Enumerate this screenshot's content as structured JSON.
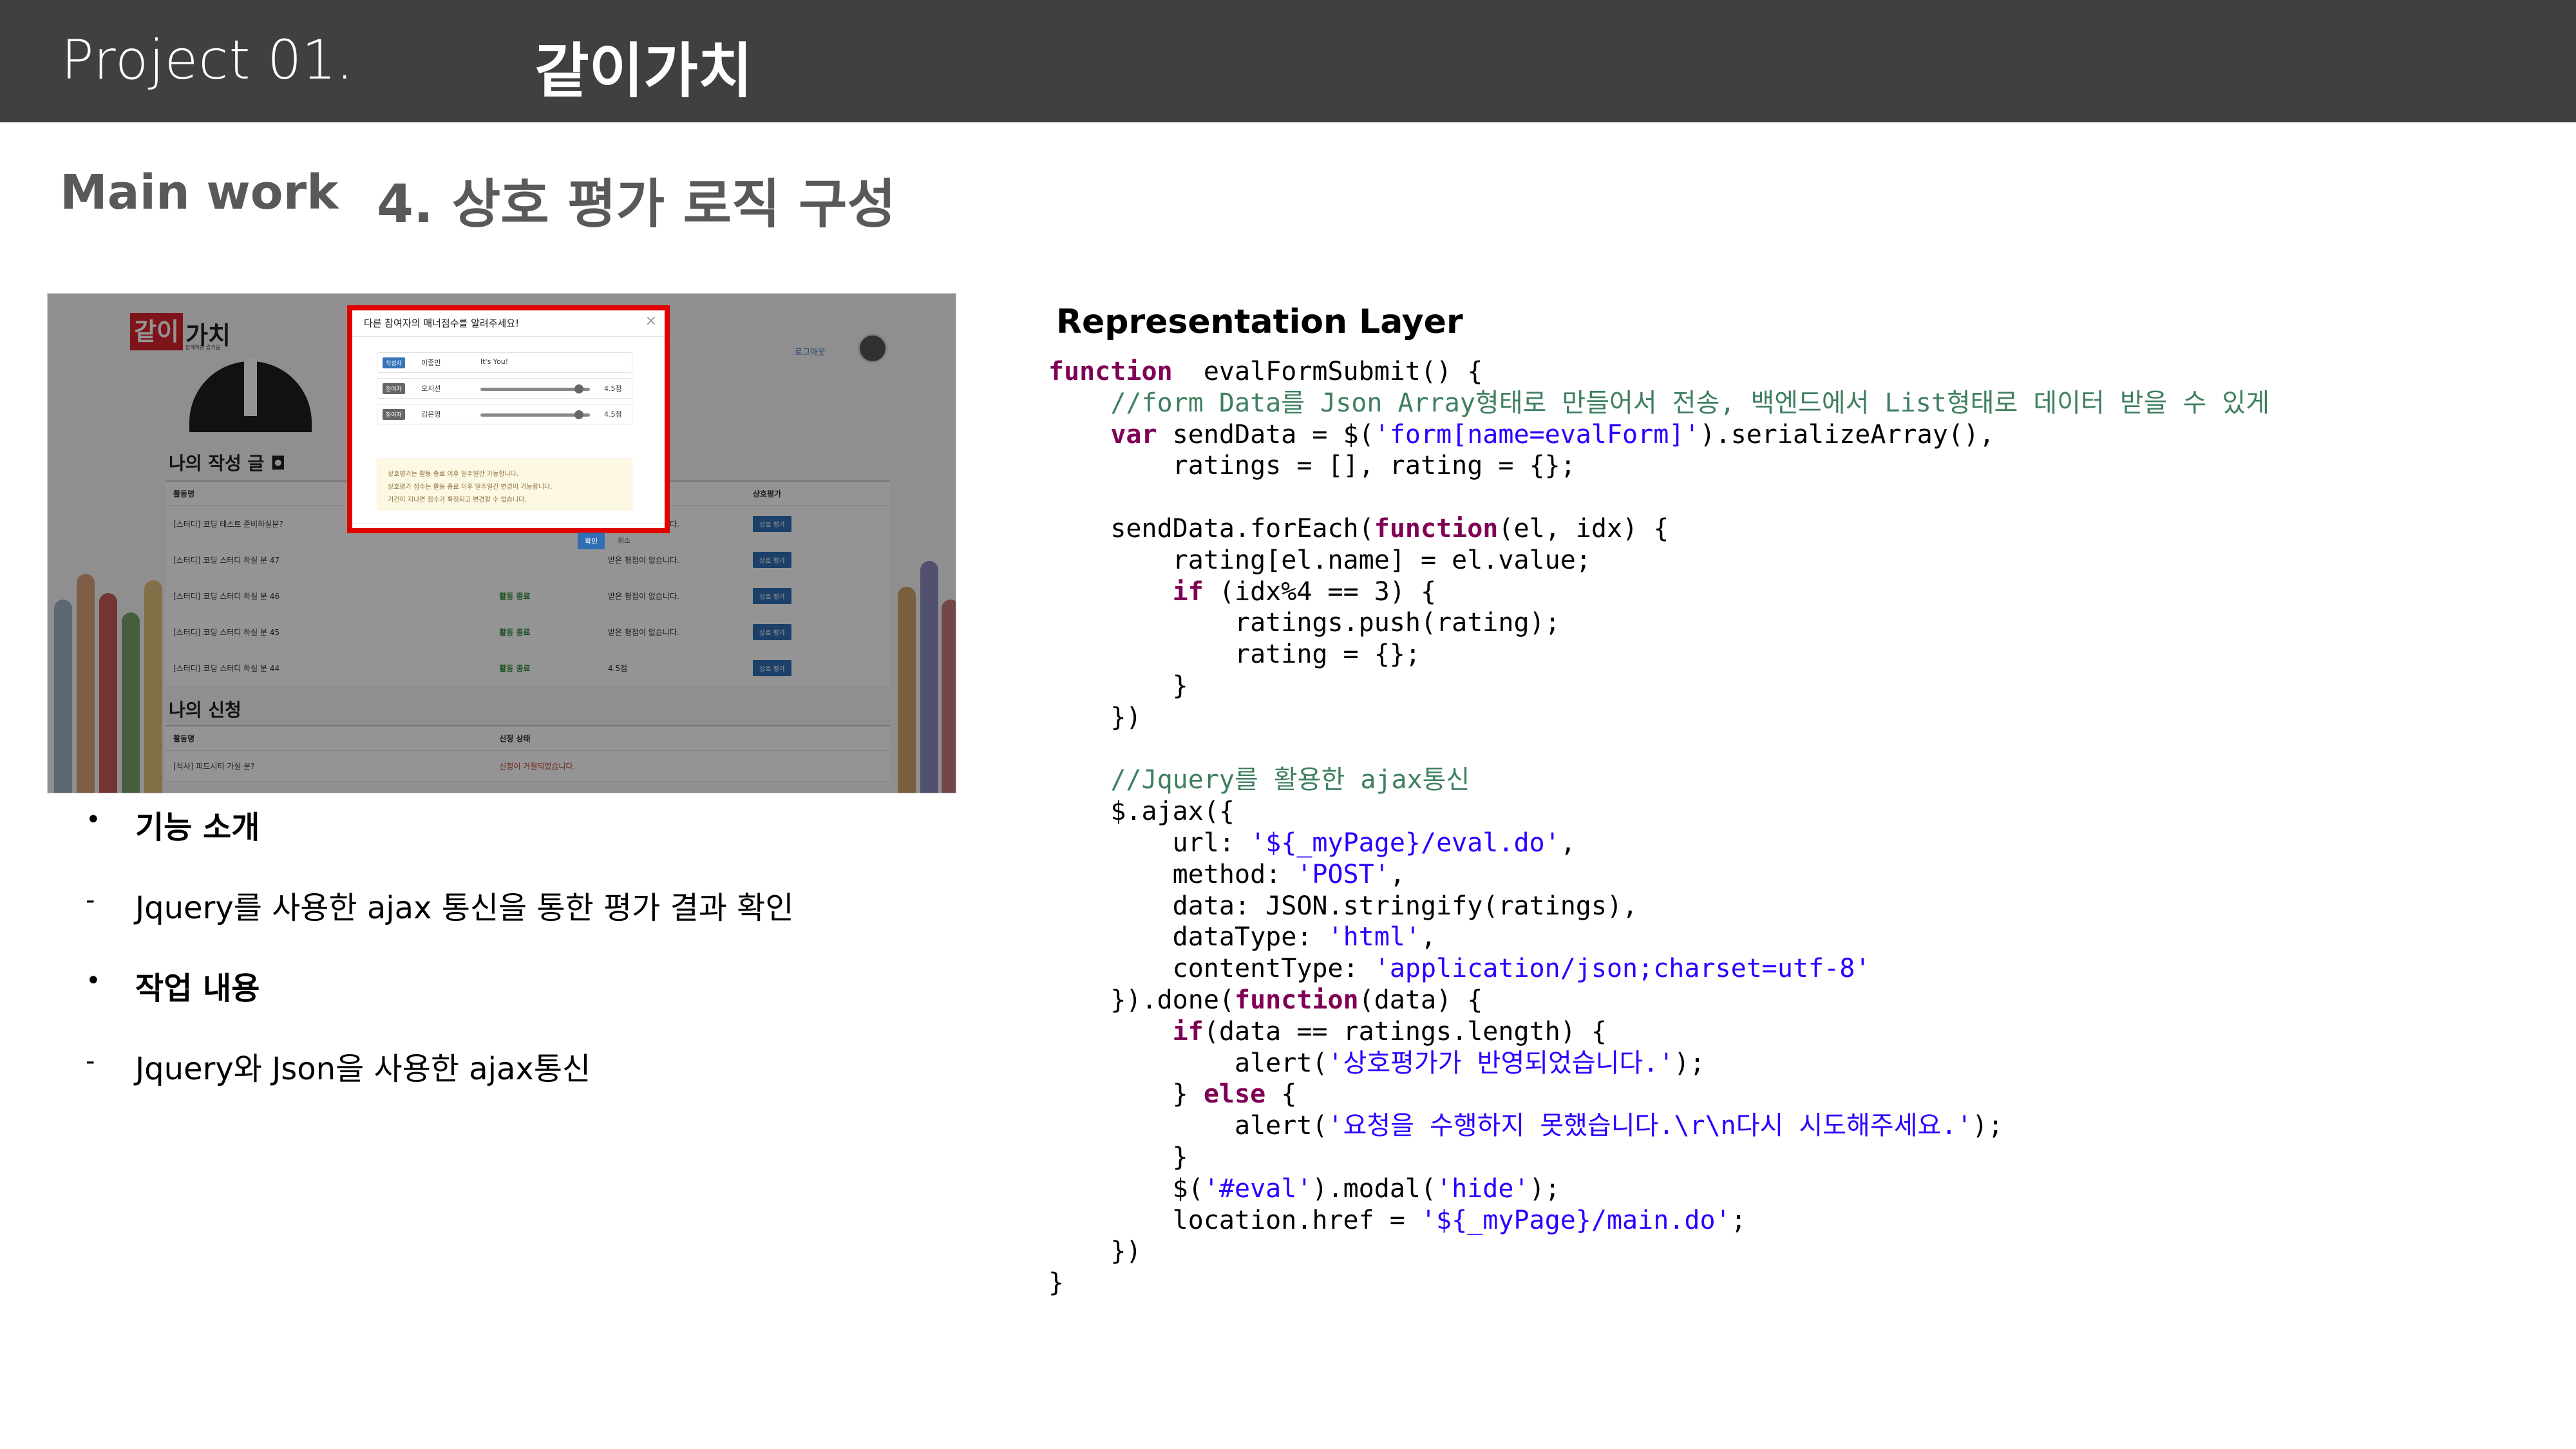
{
  "header": {
    "project_label": "Project",
    "project_number": "01.",
    "project_name": "같이가치"
  },
  "section": {
    "main_work_label": "Main work",
    "title": "4. 상호 평가 로직 구성"
  },
  "screenshot": {
    "logo": "같이",
    "logo_text": "가치",
    "logo_sub": "함께하는 즐거움",
    "nav_link": "로그아웃",
    "my_posts_heading": "나의 작성 글 ◘",
    "my_posts_columns": [
      "활동명",
      "",
      "",
      "상호평가"
    ],
    "my_posts_rows": [
      {
        "name": "[스터디] 코딩 테스트 준비하실분?",
        "status": "",
        "note": "받은 평점이 없습니다.",
        "button": "상호 평가"
      },
      {
        "name": "[스터디] 코딩 스터디 하실 분 47",
        "status": "",
        "note": "받은 평점이 없습니다.",
        "button": "상호 평가"
      },
      {
        "name": "[스터디] 코딩 스터디 하실 분 46",
        "status": "활동 종료",
        "note": "받은 평점이 없습니다.",
        "button": "상호 평가"
      },
      {
        "name": "[스터디] 코딩 스터디 하실 분 45",
        "status": "활동 종료",
        "note": "받은 평점이 없습니다.",
        "button": "상호 평가"
      },
      {
        "name": "[스터디] 코딩 스터디 하실 분 44",
        "status": "활동 종료",
        "note": "4.5점",
        "button": "상호 평가"
      }
    ],
    "my_apply_heading": "나의 신청",
    "my_apply_columns": [
      "활동명",
      "신청 상태"
    ],
    "my_apply_rows": [
      {
        "name": "[식사] 피드시티 가실 분?",
        "status": "신청이 거절되었습니다."
      }
    ],
    "modal": {
      "title": "다른 참여자의 매너점수를 알려주세요!",
      "close": "×",
      "rows": [
        {
          "badge": "작성자",
          "name": "이종민",
          "text": "It's You!",
          "value": null,
          "score": ""
        },
        {
          "badge": "참여자",
          "name": "오지선",
          "text": "",
          "value": 0.9,
          "score": "4.5점"
        },
        {
          "badge": "참여자",
          "name": "김은영",
          "text": "",
          "value": 0.9,
          "score": "4.5점"
        }
      ],
      "notices": [
        "상호평가는 활동 종료 이후 일주일간 가능합니다.",
        "상호평가 점수는 활동 종료 이후 일주일간 변경이 가능합니다.",
        "기간이 지나면 점수가 확정되고 변경할 수 없습니다."
      ],
      "confirm": "확인",
      "cancel": "취소"
    }
  },
  "bullets": [
    {
      "marker": "•",
      "text": "기능 소개",
      "bold": true
    },
    {
      "marker": "-",
      "text": "Jquery를 사용한 ajax 통신을 통한 평가 결과 확인",
      "bold": false
    },
    {
      "marker": "•",
      "text": "작업 내용",
      "bold": true
    },
    {
      "marker": "-",
      "text": "Jquery와 Json을 사용한 ajax통신",
      "bold": false
    }
  ],
  "code_title": "Representation Layer",
  "code": [
    [
      [
        "kw",
        "function"
      ],
      [
        "",
        "  evalFormSubmit() {"
      ]
    ],
    [
      [
        "cm",
        "    //form Data를 Json Array형태로 만들어서 전송, 백엔드에서 List형태로 데이터 받을 수 있게"
      ]
    ],
    [
      [
        "kw",
        "    var"
      ],
      [
        "",
        " sendData = $("
      ],
      [
        "str",
        "'form[name=evalForm]'"
      ],
      [
        "",
        ").serializeArray(),"
      ]
    ],
    [
      [
        "",
        "        ratings = [], rating = {};"
      ]
    ],
    [
      [
        "",
        ""
      ]
    ],
    [
      [
        "",
        "    sendData.forEach("
      ],
      [
        "kw",
        "function"
      ],
      [
        "",
        "(el, idx) {"
      ]
    ],
    [
      [
        "",
        "        rating[el.name] = el.value;"
      ]
    ],
    [
      [
        "kw",
        "        if"
      ],
      [
        "",
        " (idx%4 == 3) {"
      ]
    ],
    [
      [
        "",
        "            ratings.push(rating);"
      ]
    ],
    [
      [
        "",
        "            rating = {};"
      ]
    ],
    [
      [
        "",
        "        }"
      ]
    ],
    [
      [
        "",
        "    })"
      ]
    ],
    [
      [
        "",
        ""
      ]
    ],
    [
      [
        "cm",
        "    //Jquery를 활용한 ajax통신"
      ]
    ],
    [
      [
        "",
        "    $.ajax({"
      ]
    ],
    [
      [
        "",
        "        url: "
      ],
      [
        "str",
        "'${_myPage}/eval.do'"
      ],
      [
        "",
        ","
      ]
    ],
    [
      [
        "",
        "        method: "
      ],
      [
        "str",
        "'POST'"
      ],
      [
        "",
        ","
      ]
    ],
    [
      [
        "",
        "        data: JSON.stringify(ratings),"
      ]
    ],
    [
      [
        "",
        "        dataType: "
      ],
      [
        "str",
        "'html'"
      ],
      [
        "",
        ","
      ]
    ],
    [
      [
        "",
        "        contentType: "
      ],
      [
        "str",
        "'application/json;charset=utf-8'"
      ]
    ],
    [
      [
        "",
        "    }).done("
      ],
      [
        "kw",
        "function"
      ],
      [
        "",
        "(data) {"
      ]
    ],
    [
      [
        "kw",
        "        if"
      ],
      [
        "",
        "(data == ratings.length) {"
      ]
    ],
    [
      [
        "",
        "            alert("
      ],
      [
        "str",
        "'상호평가가 반영되었습니다.'"
      ],
      [
        "",
        ");"
      ]
    ],
    [
      [
        "",
        "        } "
      ],
      [
        "kw",
        "else"
      ],
      [
        "",
        " {"
      ]
    ],
    [
      [
        "",
        "            alert("
      ],
      [
        "str",
        "'요청을 수행하지 못했습니다.\\r\\n다시 시도해주세요.'"
      ],
      [
        "",
        ");"
      ]
    ],
    [
      [
        "",
        "        }"
      ]
    ],
    [
      [
        "",
        "        $("
      ],
      [
        "str",
        "'#eval'"
      ],
      [
        "",
        ").modal("
      ],
      [
        "str",
        "'hide'"
      ],
      [
        "",
        ");"
      ]
    ],
    [
      [
        "",
        "        location.href = "
      ],
      [
        "str",
        "'${_myPage}/main.do'"
      ],
      [
        "",
        ";"
      ]
    ],
    [
      [
        "",
        "    })"
      ]
    ],
    [
      [
        "",
        "}"
      ]
    ]
  ]
}
